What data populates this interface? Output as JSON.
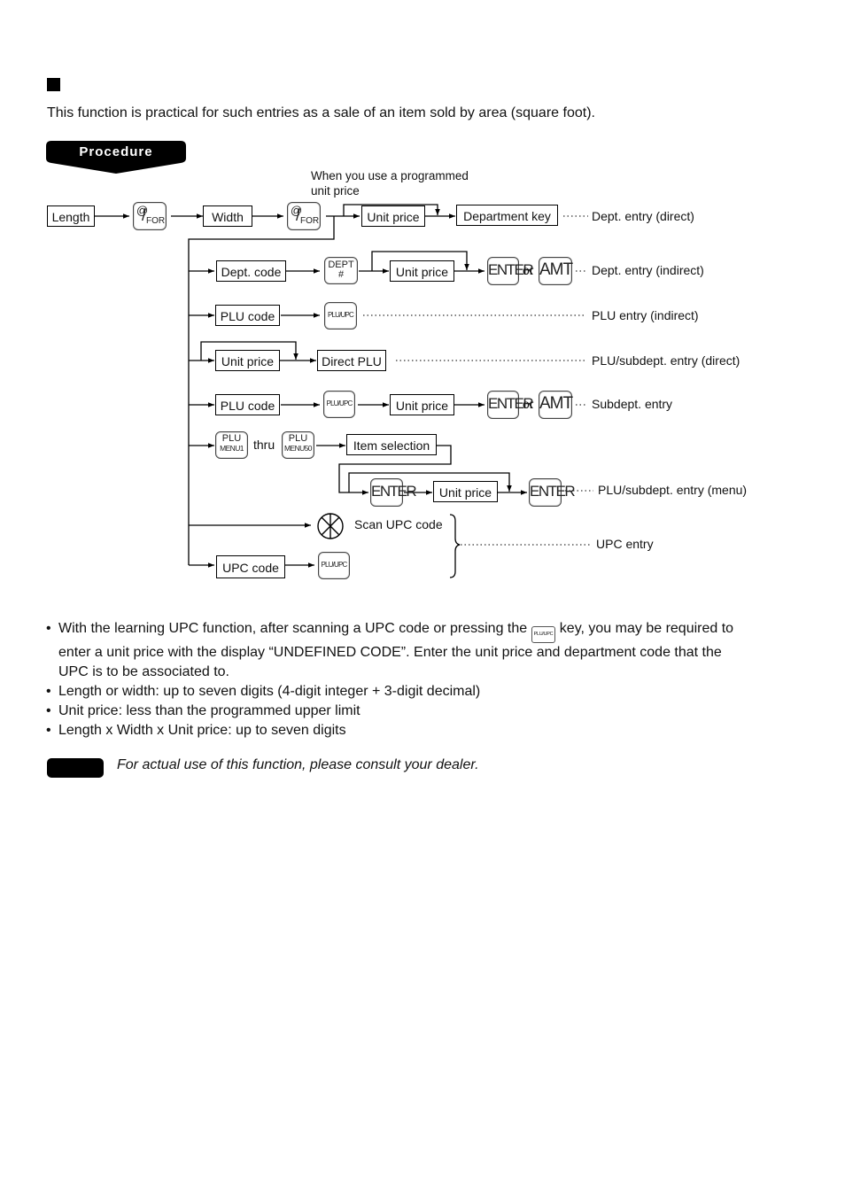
{
  "page": {
    "intro": "This function is practical for such entries as a sale of an item sold by area (square foot).",
    "procedure_label": "Procedure",
    "programmed_note_line1": "When you use a programmed",
    "programmed_note_line2": "unit price"
  },
  "diagram": {
    "row1": {
      "length": "Length",
      "for_key_at": "@",
      "for_key_for": "FOR",
      "width": "Width",
      "unit_price": "Unit price",
      "department_key": "Department key",
      "result": "Dept. entry (direct)"
    },
    "row2": {
      "dept_code": "Dept. code",
      "dept_key_top": "DEPT",
      "dept_key_bottom": "#",
      "unit_price": "Unit price",
      "enter": "ENTER",
      "or": "or",
      "amt": "AMT",
      "result": "Dept. entry (indirect)"
    },
    "row3": {
      "plu_code": "PLU code",
      "plu_upc": "PLU/UPC",
      "result": "PLU entry (indirect)"
    },
    "row4": {
      "unit_price": "Unit price",
      "direct_plu": "Direct PLU",
      "result": "PLU/subdept. entry (direct)"
    },
    "row5": {
      "plu_code": "PLU code",
      "plu_upc": "PLU/UPC",
      "unit_price": "Unit price",
      "enter": "ENTER",
      "or": "or",
      "amt": "AMT",
      "result": "Subdept. entry"
    },
    "row6": {
      "menu1_top": "PLU",
      "menu1_bottom": "MENU1",
      "thru": "thru",
      "menu50_top": "PLU",
      "menu50_bottom": "MENU50",
      "item_selection": "Item selection",
      "enter1": "ENTER",
      "unit_price": "Unit price",
      "enter2": "ENTER",
      "result": "PLU/subdept. entry (menu)"
    },
    "row7": {
      "scan": "Scan UPC code",
      "upc_code": "UPC code",
      "plu_upc": "PLU/UPC",
      "result": "UPC entry"
    }
  },
  "notes": {
    "bullets": [
      {
        "before": "With the learning UPC function, after scanning a UPC code or pressing the ",
        "key": "PLU/UPC",
        "after": " key, you may be required to enter a unit price with the display “UNDEFINED CODE”.  Enter the unit price and department code that the UPC is to be associated to."
      },
      {
        "text": "Length or width: up to seven digits (4-digit integer + 3-digit decimal)"
      },
      {
        "text": "Unit price: less than the programmed upper limit"
      },
      {
        "text": "Length x Width x Unit price: up to seven digits"
      }
    ],
    "dealer_note": "For actual use of this function, please consult your dealer."
  }
}
